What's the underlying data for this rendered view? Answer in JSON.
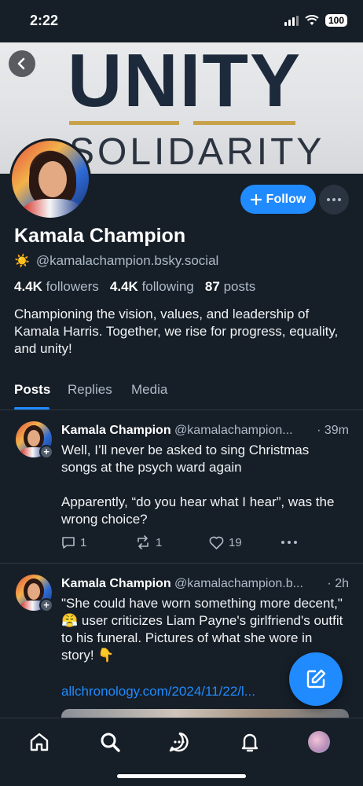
{
  "status_bar": {
    "time": "2:22",
    "battery": "100"
  },
  "banner": {
    "word1": "UNITY",
    "word2": "SOLIDARITY"
  },
  "profile": {
    "display_name": "Kamala Champion",
    "handle": "@kamalachampion.bsky.social",
    "handle_emoji": "☀️",
    "followers_count": "4.4K",
    "followers_label": "followers",
    "following_count": "4.4K",
    "following_label": "following",
    "posts_count": "87",
    "posts_label": "posts",
    "bio": "Championing the vision, values, and leadership of Kamala Harris. Together, we rise for progress, equality, and unity!",
    "follow_label": "Follow"
  },
  "tabs": [
    {
      "label": "Posts",
      "active": true
    },
    {
      "label": "Replies",
      "active": false
    },
    {
      "label": "Media",
      "active": false
    }
  ],
  "posts": [
    {
      "author": "Kamala Champion",
      "handle": "@kamalachampion...",
      "time": "· 39m",
      "text": "Well, I’ll never be asked to sing Christmas songs at the psych ward again\n\nApparently, “do you hear what I hear”,  was the wrong choice?",
      "replies": "1",
      "reposts": "1",
      "likes": "19"
    },
    {
      "author": "Kamala Champion",
      "handle": "@kamalachampion.b...",
      "time": "· 2h",
      "text": "\"She could have worn something more decent,\" 😤 user criticizes Liam Payne's girlfriend's outfit to his funeral. Pictures of what she wore in story! 👇",
      "link": "allchronology.com/2024/11/22/l..."
    }
  ],
  "colors": {
    "accent": "#208bfe",
    "background": "#161e27",
    "muted": "#aebbc9"
  },
  "icons": [
    "back-arrow-icon",
    "plus-icon",
    "ellipsis-icon",
    "reply-icon",
    "repost-icon",
    "heart-icon",
    "compose-icon",
    "home-icon",
    "search-icon",
    "chat-icon",
    "bell-icon"
  ]
}
